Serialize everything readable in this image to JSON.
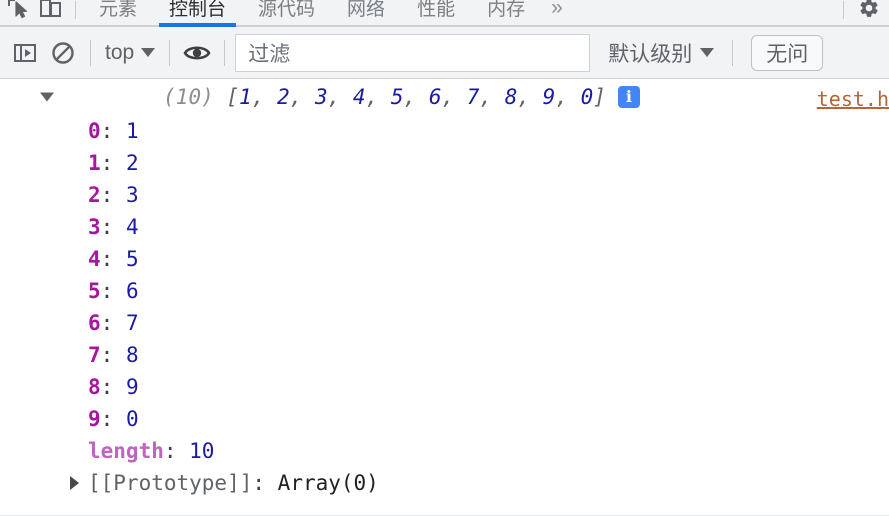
{
  "window": {
    "app": "Chrome DevTools",
    "panel": "Console"
  },
  "tabbar": {
    "inspect_icon": "inspect-element-icon",
    "device_icon": "device-toolbar-icon",
    "overflow_label": "»",
    "settings_icon": "gear-icon",
    "tabs": [
      {
        "label": "元素",
        "active": false
      },
      {
        "label": "控制台",
        "active": true
      },
      {
        "label": "源代码",
        "active": false
      },
      {
        "label": "网络",
        "active": false
      },
      {
        "label": "性能",
        "active": false
      },
      {
        "label": "内存",
        "active": false
      }
    ],
    "active_underline_color": "#1a73e8"
  },
  "console_toolbar": {
    "sidebar_toggle_icon": "show-console-sidebar-icon",
    "clear_icon": "clear-console-icon",
    "context_label": "top",
    "eye_icon": "live-expression-eye-icon",
    "filter": {
      "placeholder": "过滤",
      "value": ""
    },
    "level_label": "默认级别",
    "issues_label": "无问"
  },
  "console_output": {
    "entry": {
      "expanded": true,
      "disclosure": "expanded-triangle-icon",
      "count_label": "(10)",
      "open_bracket": "[",
      "items": [
        "1",
        "2",
        "3",
        "4",
        "5",
        "6",
        "7",
        "8",
        "9",
        "0"
      ],
      "separator": ", ",
      "close_bracket": "]",
      "badge_icon": "info-badge-icon",
      "badge_glyph": "i",
      "source_link": "test.h"
    },
    "properties": [
      {
        "key": "0",
        "value": "1",
        "kind": "index"
      },
      {
        "key": "1",
        "value": "2",
        "kind": "index"
      },
      {
        "key": "2",
        "value": "3",
        "kind": "index"
      },
      {
        "key": "3",
        "value": "4",
        "kind": "index"
      },
      {
        "key": "4",
        "value": "5",
        "kind": "index"
      },
      {
        "key": "5",
        "value": "6",
        "kind": "index"
      },
      {
        "key": "6",
        "value": "7",
        "kind": "index"
      },
      {
        "key": "7",
        "value": "8",
        "kind": "index"
      },
      {
        "key": "8",
        "value": "9",
        "kind": "index"
      },
      {
        "key": "9",
        "value": "0",
        "kind": "index"
      },
      {
        "key": "length",
        "value": "10",
        "kind": "length"
      }
    ],
    "prototype": {
      "disclosure": "collapsed-triangle-icon",
      "key": "[[Prototype]]",
      "value": "Array(0)"
    },
    "colon": ": "
  },
  "colors": {
    "accent": "#1a73e8",
    "toolbar_bg": "#f1f3f4",
    "number": "#1a1aa6",
    "index_key": "#a6169e",
    "length_key": "#c163c1",
    "link": "#b4653a",
    "badge": "#4285f4"
  }
}
